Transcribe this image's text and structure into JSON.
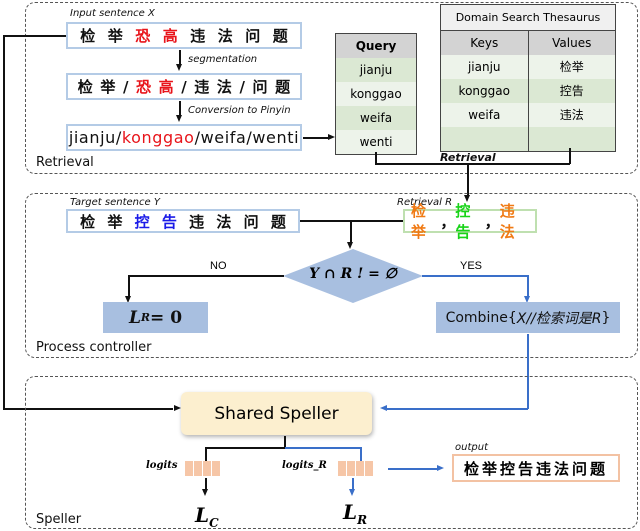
{
  "retrieval_section": {
    "label": "Retrieval",
    "input_label": "Input sentence X",
    "input_chars": [
      "检",
      "举",
      "恐",
      "高",
      "违",
      "法",
      "问",
      "题"
    ],
    "input_highlight_indices": [
      2,
      3
    ],
    "segmentation_label": "segmentation",
    "segmented_chars": [
      "检",
      "举",
      "/",
      "恐",
      "高",
      "/",
      "违",
      "法",
      "/",
      "问",
      "题"
    ],
    "segmented_highlight_indices": [
      3,
      4
    ],
    "pinyin_label": "Conversion to Pinyin",
    "pinyin_parts": {
      "p1": "jianju/",
      "p2": "konggao",
      "p3": "/weifa/wenti"
    },
    "query_table": {
      "header": "Query",
      "rows": [
        "jianju",
        "konggao",
        "weifa",
        "wenti"
      ]
    },
    "thesaurus": {
      "title": "Domain Search Thesaurus",
      "col_keys": "Keys",
      "col_values": "Values",
      "rows": [
        {
          "key": "jianju",
          "value": "检举"
        },
        {
          "key": "konggao",
          "value": "控告"
        },
        {
          "key": "weifa",
          "value": "违法"
        },
        {
          "key": "",
          "value": ""
        }
      ]
    },
    "retrieval_connector_label": "Retrieval"
  },
  "process_section": {
    "label": "Process controller",
    "target_label": "Target sentence Y",
    "target_chars": [
      "检",
      "举",
      "控",
      "告",
      "违",
      "法",
      "问",
      "题"
    ],
    "target_highlight_indices": [
      2,
      3
    ],
    "retrieval_r_label": "Retrieval R",
    "retrieval_r": {
      "w1": "检举",
      "sep1": "，",
      "w2": "控告",
      "sep2": "，",
      "w3": "违法"
    },
    "decision": "Y ∩ R ! = ∅",
    "no_label": "NO",
    "yes_label": "YES",
    "no_result": "L",
    "no_result_sub": "R",
    "no_result_rhs": " = 0",
    "combine_prefix": "Combine{",
    "combine_italic": "X//检索词是R",
    "combine_suffix": " }"
  },
  "speller_section": {
    "label": "Speller",
    "shared_speller": "Shared Speller",
    "logits_label": "logits",
    "logits_r_label": "logits_R",
    "loss_c": "L",
    "loss_c_sub": "C",
    "loss_r": "L",
    "loss_r_sub": "R",
    "output_label": "output",
    "output_text": "检举控告违法问题"
  },
  "colors": {
    "error_red": "#e8141a",
    "correct_blue": "#1a1ae8",
    "flow_blue": "#3a6fc9",
    "box_blue": "#a8bfe0",
    "speller_fill": "#fcefcf",
    "logit_fill": "#f6c6a7",
    "table_green": "#dbe8d3"
  }
}
